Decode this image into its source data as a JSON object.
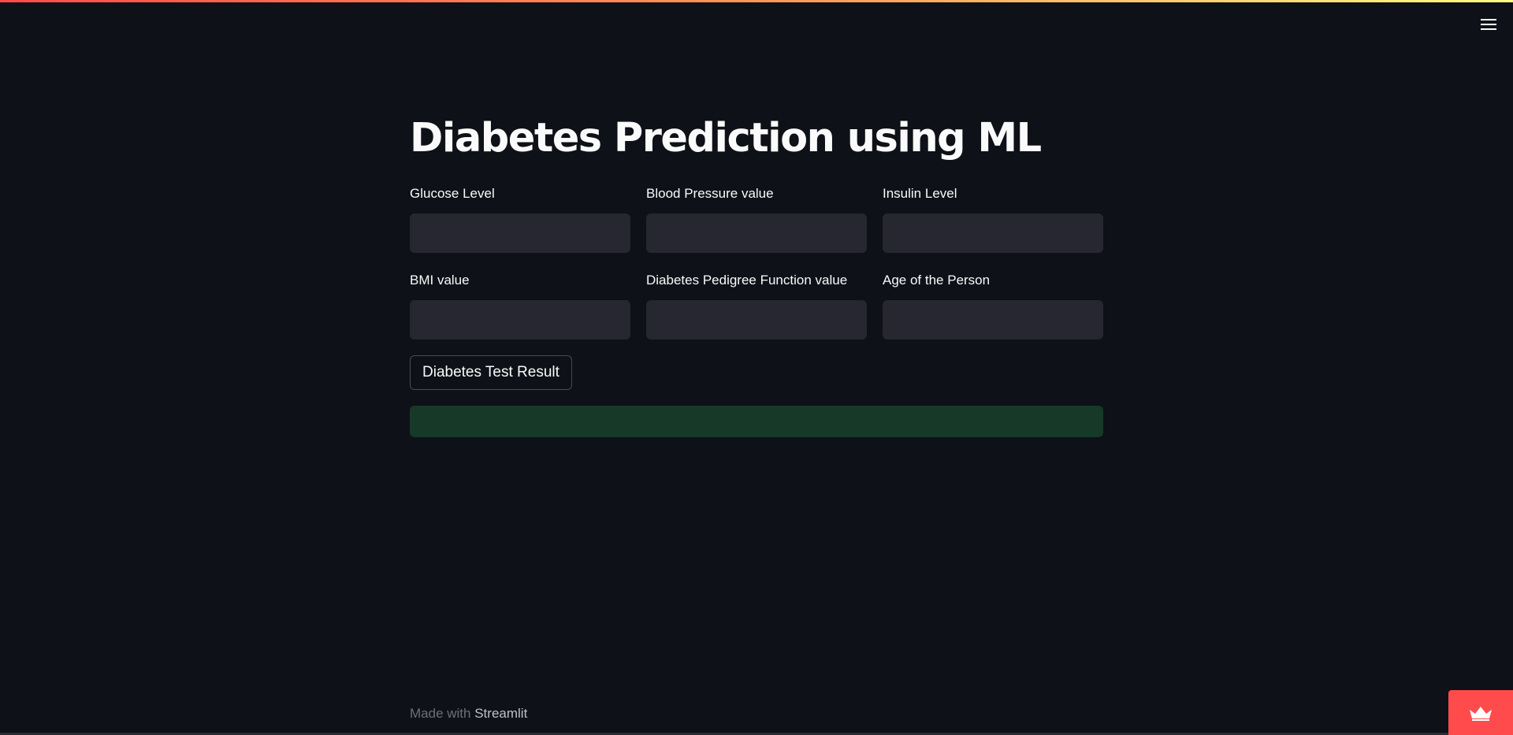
{
  "app": {
    "title": "Diabetes Prediction using ML"
  },
  "header": {
    "menu_icon": "hamburger-menu-icon"
  },
  "form": {
    "fields": [
      {
        "label": "Glucose Level",
        "value": ""
      },
      {
        "label": "Blood Pressure value",
        "value": ""
      },
      {
        "label": "Insulin Level",
        "value": ""
      },
      {
        "label": "BMI value",
        "value": ""
      },
      {
        "label": "Diabetes Pedigree Function value",
        "value": ""
      },
      {
        "label": "Age of the Person",
        "value": ""
      }
    ],
    "submit_label": "Diabetes Test Result"
  },
  "result": {
    "text": ""
  },
  "footer": {
    "prefix": "Made with",
    "link_text": "Streamlit"
  },
  "badge": {
    "icon": "crown-icon"
  },
  "colors": {
    "background": "#0e1117",
    "input_background": "#262730",
    "success_background": "#173928",
    "accent": "#ff4b4b",
    "text": "#fafafa"
  }
}
